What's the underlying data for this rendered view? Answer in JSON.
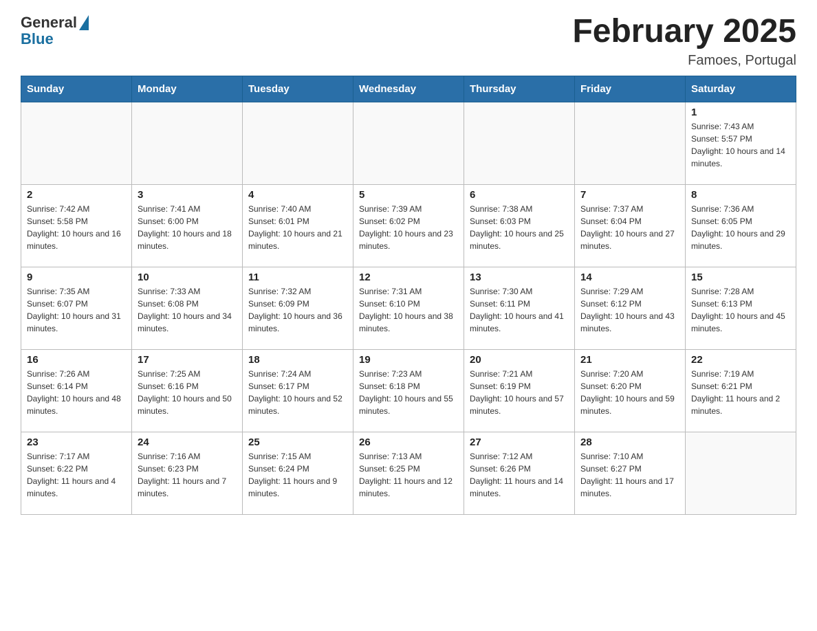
{
  "header": {
    "logo_general": "General",
    "logo_blue": "Blue",
    "month_title": "February 2025",
    "location": "Famoes, Portugal"
  },
  "days_of_week": [
    "Sunday",
    "Monday",
    "Tuesday",
    "Wednesday",
    "Thursday",
    "Friday",
    "Saturday"
  ],
  "weeks": [
    [
      {
        "day": "",
        "sunrise": "",
        "sunset": "",
        "daylight": ""
      },
      {
        "day": "",
        "sunrise": "",
        "sunset": "",
        "daylight": ""
      },
      {
        "day": "",
        "sunrise": "",
        "sunset": "",
        "daylight": ""
      },
      {
        "day": "",
        "sunrise": "",
        "sunset": "",
        "daylight": ""
      },
      {
        "day": "",
        "sunrise": "",
        "sunset": "",
        "daylight": ""
      },
      {
        "day": "",
        "sunrise": "",
        "sunset": "",
        "daylight": ""
      },
      {
        "day": "1",
        "sunrise": "Sunrise: 7:43 AM",
        "sunset": "Sunset: 5:57 PM",
        "daylight": "Daylight: 10 hours and 14 minutes."
      }
    ],
    [
      {
        "day": "2",
        "sunrise": "Sunrise: 7:42 AM",
        "sunset": "Sunset: 5:58 PM",
        "daylight": "Daylight: 10 hours and 16 minutes."
      },
      {
        "day": "3",
        "sunrise": "Sunrise: 7:41 AM",
        "sunset": "Sunset: 6:00 PM",
        "daylight": "Daylight: 10 hours and 18 minutes."
      },
      {
        "day": "4",
        "sunrise": "Sunrise: 7:40 AM",
        "sunset": "Sunset: 6:01 PM",
        "daylight": "Daylight: 10 hours and 21 minutes."
      },
      {
        "day": "5",
        "sunrise": "Sunrise: 7:39 AM",
        "sunset": "Sunset: 6:02 PM",
        "daylight": "Daylight: 10 hours and 23 minutes."
      },
      {
        "day": "6",
        "sunrise": "Sunrise: 7:38 AM",
        "sunset": "Sunset: 6:03 PM",
        "daylight": "Daylight: 10 hours and 25 minutes."
      },
      {
        "day": "7",
        "sunrise": "Sunrise: 7:37 AM",
        "sunset": "Sunset: 6:04 PM",
        "daylight": "Daylight: 10 hours and 27 minutes."
      },
      {
        "day": "8",
        "sunrise": "Sunrise: 7:36 AM",
        "sunset": "Sunset: 6:05 PM",
        "daylight": "Daylight: 10 hours and 29 minutes."
      }
    ],
    [
      {
        "day": "9",
        "sunrise": "Sunrise: 7:35 AM",
        "sunset": "Sunset: 6:07 PM",
        "daylight": "Daylight: 10 hours and 31 minutes."
      },
      {
        "day": "10",
        "sunrise": "Sunrise: 7:33 AM",
        "sunset": "Sunset: 6:08 PM",
        "daylight": "Daylight: 10 hours and 34 minutes."
      },
      {
        "day": "11",
        "sunrise": "Sunrise: 7:32 AM",
        "sunset": "Sunset: 6:09 PM",
        "daylight": "Daylight: 10 hours and 36 minutes."
      },
      {
        "day": "12",
        "sunrise": "Sunrise: 7:31 AM",
        "sunset": "Sunset: 6:10 PM",
        "daylight": "Daylight: 10 hours and 38 minutes."
      },
      {
        "day": "13",
        "sunrise": "Sunrise: 7:30 AM",
        "sunset": "Sunset: 6:11 PM",
        "daylight": "Daylight: 10 hours and 41 minutes."
      },
      {
        "day": "14",
        "sunrise": "Sunrise: 7:29 AM",
        "sunset": "Sunset: 6:12 PM",
        "daylight": "Daylight: 10 hours and 43 minutes."
      },
      {
        "day": "15",
        "sunrise": "Sunrise: 7:28 AM",
        "sunset": "Sunset: 6:13 PM",
        "daylight": "Daylight: 10 hours and 45 minutes."
      }
    ],
    [
      {
        "day": "16",
        "sunrise": "Sunrise: 7:26 AM",
        "sunset": "Sunset: 6:14 PM",
        "daylight": "Daylight: 10 hours and 48 minutes."
      },
      {
        "day": "17",
        "sunrise": "Sunrise: 7:25 AM",
        "sunset": "Sunset: 6:16 PM",
        "daylight": "Daylight: 10 hours and 50 minutes."
      },
      {
        "day": "18",
        "sunrise": "Sunrise: 7:24 AM",
        "sunset": "Sunset: 6:17 PM",
        "daylight": "Daylight: 10 hours and 52 minutes."
      },
      {
        "day": "19",
        "sunrise": "Sunrise: 7:23 AM",
        "sunset": "Sunset: 6:18 PM",
        "daylight": "Daylight: 10 hours and 55 minutes."
      },
      {
        "day": "20",
        "sunrise": "Sunrise: 7:21 AM",
        "sunset": "Sunset: 6:19 PM",
        "daylight": "Daylight: 10 hours and 57 minutes."
      },
      {
        "day": "21",
        "sunrise": "Sunrise: 7:20 AM",
        "sunset": "Sunset: 6:20 PM",
        "daylight": "Daylight: 10 hours and 59 minutes."
      },
      {
        "day": "22",
        "sunrise": "Sunrise: 7:19 AM",
        "sunset": "Sunset: 6:21 PM",
        "daylight": "Daylight: 11 hours and 2 minutes."
      }
    ],
    [
      {
        "day": "23",
        "sunrise": "Sunrise: 7:17 AM",
        "sunset": "Sunset: 6:22 PM",
        "daylight": "Daylight: 11 hours and 4 minutes."
      },
      {
        "day": "24",
        "sunrise": "Sunrise: 7:16 AM",
        "sunset": "Sunset: 6:23 PM",
        "daylight": "Daylight: 11 hours and 7 minutes."
      },
      {
        "day": "25",
        "sunrise": "Sunrise: 7:15 AM",
        "sunset": "Sunset: 6:24 PM",
        "daylight": "Daylight: 11 hours and 9 minutes."
      },
      {
        "day": "26",
        "sunrise": "Sunrise: 7:13 AM",
        "sunset": "Sunset: 6:25 PM",
        "daylight": "Daylight: 11 hours and 12 minutes."
      },
      {
        "day": "27",
        "sunrise": "Sunrise: 7:12 AM",
        "sunset": "Sunset: 6:26 PM",
        "daylight": "Daylight: 11 hours and 14 minutes."
      },
      {
        "day": "28",
        "sunrise": "Sunrise: 7:10 AM",
        "sunset": "Sunset: 6:27 PM",
        "daylight": "Daylight: 11 hours and 17 minutes."
      },
      {
        "day": "",
        "sunrise": "",
        "sunset": "",
        "daylight": ""
      }
    ]
  ]
}
